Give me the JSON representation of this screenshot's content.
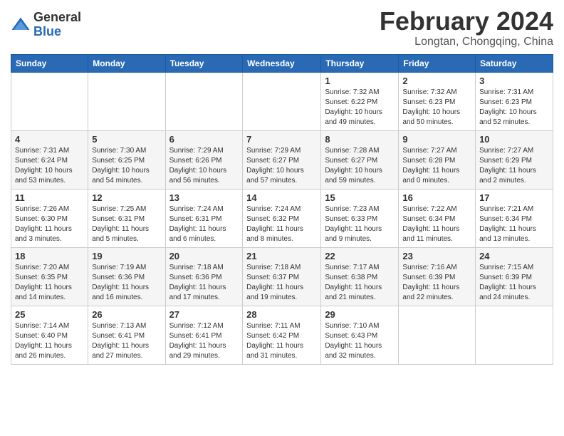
{
  "logo": {
    "general": "General",
    "blue": "Blue"
  },
  "header": {
    "title": "February 2024",
    "subtitle": "Longtan, Chongqing, China"
  },
  "weekdays": [
    "Sunday",
    "Monday",
    "Tuesday",
    "Wednesday",
    "Thursday",
    "Friday",
    "Saturday"
  ],
  "weeks": [
    [
      {
        "day": "",
        "info": ""
      },
      {
        "day": "",
        "info": ""
      },
      {
        "day": "",
        "info": ""
      },
      {
        "day": "",
        "info": ""
      },
      {
        "day": "1",
        "info": "Sunrise: 7:32 AM\nSunset: 6:22 PM\nDaylight: 10 hours and 49 minutes."
      },
      {
        "day": "2",
        "info": "Sunrise: 7:32 AM\nSunset: 6:23 PM\nDaylight: 10 hours and 50 minutes."
      },
      {
        "day": "3",
        "info": "Sunrise: 7:31 AM\nSunset: 6:23 PM\nDaylight: 10 hours and 52 minutes."
      }
    ],
    [
      {
        "day": "4",
        "info": "Sunrise: 7:31 AM\nSunset: 6:24 PM\nDaylight: 10 hours and 53 minutes."
      },
      {
        "day": "5",
        "info": "Sunrise: 7:30 AM\nSunset: 6:25 PM\nDaylight: 10 hours and 54 minutes."
      },
      {
        "day": "6",
        "info": "Sunrise: 7:29 AM\nSunset: 6:26 PM\nDaylight: 10 hours and 56 minutes."
      },
      {
        "day": "7",
        "info": "Sunrise: 7:29 AM\nSunset: 6:27 PM\nDaylight: 10 hours and 57 minutes."
      },
      {
        "day": "8",
        "info": "Sunrise: 7:28 AM\nSunset: 6:27 PM\nDaylight: 10 hours and 59 minutes."
      },
      {
        "day": "9",
        "info": "Sunrise: 7:27 AM\nSunset: 6:28 PM\nDaylight: 11 hours and 0 minutes."
      },
      {
        "day": "10",
        "info": "Sunrise: 7:27 AM\nSunset: 6:29 PM\nDaylight: 11 hours and 2 minutes."
      }
    ],
    [
      {
        "day": "11",
        "info": "Sunrise: 7:26 AM\nSunset: 6:30 PM\nDaylight: 11 hours and 3 minutes."
      },
      {
        "day": "12",
        "info": "Sunrise: 7:25 AM\nSunset: 6:31 PM\nDaylight: 11 hours and 5 minutes."
      },
      {
        "day": "13",
        "info": "Sunrise: 7:24 AM\nSunset: 6:31 PM\nDaylight: 11 hours and 6 minutes."
      },
      {
        "day": "14",
        "info": "Sunrise: 7:24 AM\nSunset: 6:32 PM\nDaylight: 11 hours and 8 minutes."
      },
      {
        "day": "15",
        "info": "Sunrise: 7:23 AM\nSunset: 6:33 PM\nDaylight: 11 hours and 9 minutes."
      },
      {
        "day": "16",
        "info": "Sunrise: 7:22 AM\nSunset: 6:34 PM\nDaylight: 11 hours and 11 minutes."
      },
      {
        "day": "17",
        "info": "Sunrise: 7:21 AM\nSunset: 6:34 PM\nDaylight: 11 hours and 13 minutes."
      }
    ],
    [
      {
        "day": "18",
        "info": "Sunrise: 7:20 AM\nSunset: 6:35 PM\nDaylight: 11 hours and 14 minutes."
      },
      {
        "day": "19",
        "info": "Sunrise: 7:19 AM\nSunset: 6:36 PM\nDaylight: 11 hours and 16 minutes."
      },
      {
        "day": "20",
        "info": "Sunrise: 7:18 AM\nSunset: 6:36 PM\nDaylight: 11 hours and 17 minutes."
      },
      {
        "day": "21",
        "info": "Sunrise: 7:18 AM\nSunset: 6:37 PM\nDaylight: 11 hours and 19 minutes."
      },
      {
        "day": "22",
        "info": "Sunrise: 7:17 AM\nSunset: 6:38 PM\nDaylight: 11 hours and 21 minutes."
      },
      {
        "day": "23",
        "info": "Sunrise: 7:16 AM\nSunset: 6:39 PM\nDaylight: 11 hours and 22 minutes."
      },
      {
        "day": "24",
        "info": "Sunrise: 7:15 AM\nSunset: 6:39 PM\nDaylight: 11 hours and 24 minutes."
      }
    ],
    [
      {
        "day": "25",
        "info": "Sunrise: 7:14 AM\nSunset: 6:40 PM\nDaylight: 11 hours and 26 minutes."
      },
      {
        "day": "26",
        "info": "Sunrise: 7:13 AM\nSunset: 6:41 PM\nDaylight: 11 hours and 27 minutes."
      },
      {
        "day": "27",
        "info": "Sunrise: 7:12 AM\nSunset: 6:41 PM\nDaylight: 11 hours and 29 minutes."
      },
      {
        "day": "28",
        "info": "Sunrise: 7:11 AM\nSunset: 6:42 PM\nDaylight: 11 hours and 31 minutes."
      },
      {
        "day": "29",
        "info": "Sunrise: 7:10 AM\nSunset: 6:43 PM\nDaylight: 11 hours and 32 minutes."
      },
      {
        "day": "",
        "info": ""
      },
      {
        "day": "",
        "info": ""
      }
    ]
  ]
}
